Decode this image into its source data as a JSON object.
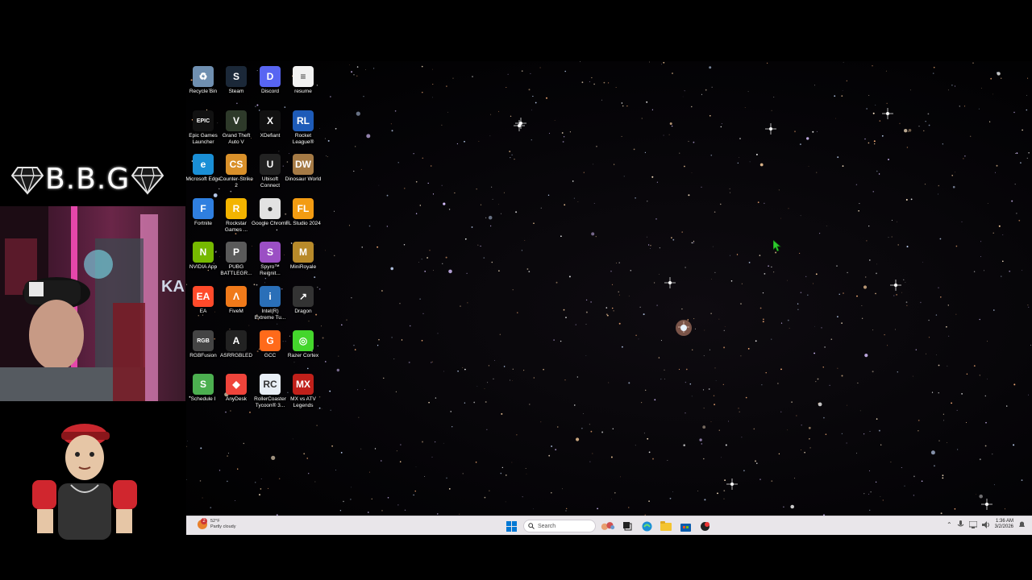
{
  "overlay": {
    "brand_text": "B.B.G",
    "webcam_sign": "KA"
  },
  "desktop": {
    "icons": [
      {
        "label": "Recycle Bin",
        "icon": "recycle-bin-icon",
        "color": "#6f8fb0",
        "glyph": "♻"
      },
      {
        "label": "Steam",
        "icon": "steam-icon",
        "color": "#1b2838",
        "glyph": "S"
      },
      {
        "label": "Discord",
        "icon": "discord-icon",
        "color": "#5865f2",
        "glyph": "D"
      },
      {
        "label": "resume",
        "icon": "document-icon",
        "color": "#f2f2f2",
        "glyph": "≡"
      },
      {
        "label": "Epic Games Launcher",
        "icon": "epic-games-icon",
        "color": "#111111",
        "glyph": "EPIC"
      },
      {
        "label": "Grand Theft Auto V",
        "icon": "gta-v-icon",
        "color": "#2e3a2a",
        "glyph": "V"
      },
      {
        "label": "XDefiant",
        "icon": "xdefiant-icon",
        "color": "#111111",
        "glyph": "X"
      },
      {
        "label": "Rocket League®",
        "icon": "rocket-league-icon",
        "color": "#1e5bb8",
        "glyph": "RL"
      },
      {
        "label": "Microsoft Edge",
        "icon": "edge-icon",
        "color": "#1a8fd6",
        "glyph": "e"
      },
      {
        "label": "Counter-Strike 2",
        "icon": "counter-strike-icon",
        "color": "#d9902a",
        "glyph": "CS"
      },
      {
        "label": "Ubisoft Connect",
        "icon": "ubisoft-icon",
        "color": "#222222",
        "glyph": "U"
      },
      {
        "label": "Dinosaur World",
        "icon": "dinosaur-world-icon",
        "color": "#a57a45",
        "glyph": "DW"
      },
      {
        "label": "Fortnite",
        "icon": "fortnite-icon",
        "color": "#2f7fe0",
        "glyph": "F"
      },
      {
        "label": "Rockstar Games ...",
        "icon": "rockstar-icon",
        "color": "#f3b400",
        "glyph": "R"
      },
      {
        "label": "Google Chrome",
        "icon": "chrome-icon",
        "color": "#e2e2e2",
        "glyph": "●"
      },
      {
        "label": "FL Studio 2024",
        "icon": "fl-studio-icon",
        "color": "#f39c12",
        "glyph": "FL"
      },
      {
        "label": "NVIDIA App",
        "icon": "nvidia-icon",
        "color": "#76b900",
        "glyph": "N"
      },
      {
        "label": "PUBG BATTLEGR...",
        "icon": "pubg-icon",
        "color": "#5a5a5a",
        "glyph": "P"
      },
      {
        "label": "Spyro™ Reignit...",
        "icon": "spyro-icon",
        "color": "#9b4fc4",
        "glyph": "S"
      },
      {
        "label": "MiniRoyale",
        "icon": "miniroyale-icon",
        "color": "#b88a2a",
        "glyph": "M"
      },
      {
        "label": "EA",
        "icon": "ea-icon",
        "color": "#ff4a2a",
        "glyph": "EA"
      },
      {
        "label": "FiveM",
        "icon": "fivem-icon",
        "color": "#f07a1a",
        "glyph": "Λ"
      },
      {
        "label": "Intel(R) Extreme Tu...",
        "icon": "intel-xtu-icon",
        "color": "#2a6fb8",
        "glyph": "i"
      },
      {
        "label": "Dragon",
        "icon": "dragon-shortcut-icon",
        "color": "#333333",
        "glyph": "↗"
      },
      {
        "label": "RGBFusion",
        "icon": "rgb-fusion-icon",
        "color": "#444444",
        "glyph": "RGB"
      },
      {
        "label": "ASRRGBLED",
        "icon": "asrock-rgb-icon",
        "color": "#222222",
        "glyph": "A"
      },
      {
        "label": "GCC",
        "icon": "gcc-icon",
        "color": "#ff6a1a",
        "glyph": "G"
      },
      {
        "label": "Razer Cortex",
        "icon": "razer-cortex-icon",
        "color": "#44d62c",
        "glyph": "◎"
      },
      {
        "label": "Schedule I",
        "icon": "schedule-one-icon",
        "color": "#4caf50",
        "glyph": "S"
      },
      {
        "label": "AnyDesk",
        "icon": "anydesk-icon",
        "color": "#ef443b",
        "glyph": "◆"
      },
      {
        "label": "RollerCoaster Tycoon® 3...",
        "icon": "rollercoaster-tycoon-icon",
        "color": "#e8eef5",
        "glyph": "RC"
      },
      {
        "label": "MX vs ATV Legends",
        "icon": "mx-vs-atv-icon",
        "color": "#c0201a",
        "glyph": "MX"
      }
    ]
  },
  "taskbar": {
    "weather_temp": "52°F",
    "weather_desc": "Partly cloudy",
    "weather_badge": "2",
    "search_placeholder": "Search",
    "clock_time": "1:36 AM",
    "clock_date": "3/2/2026",
    "colors": {
      "accent": "#0078d4"
    }
  }
}
